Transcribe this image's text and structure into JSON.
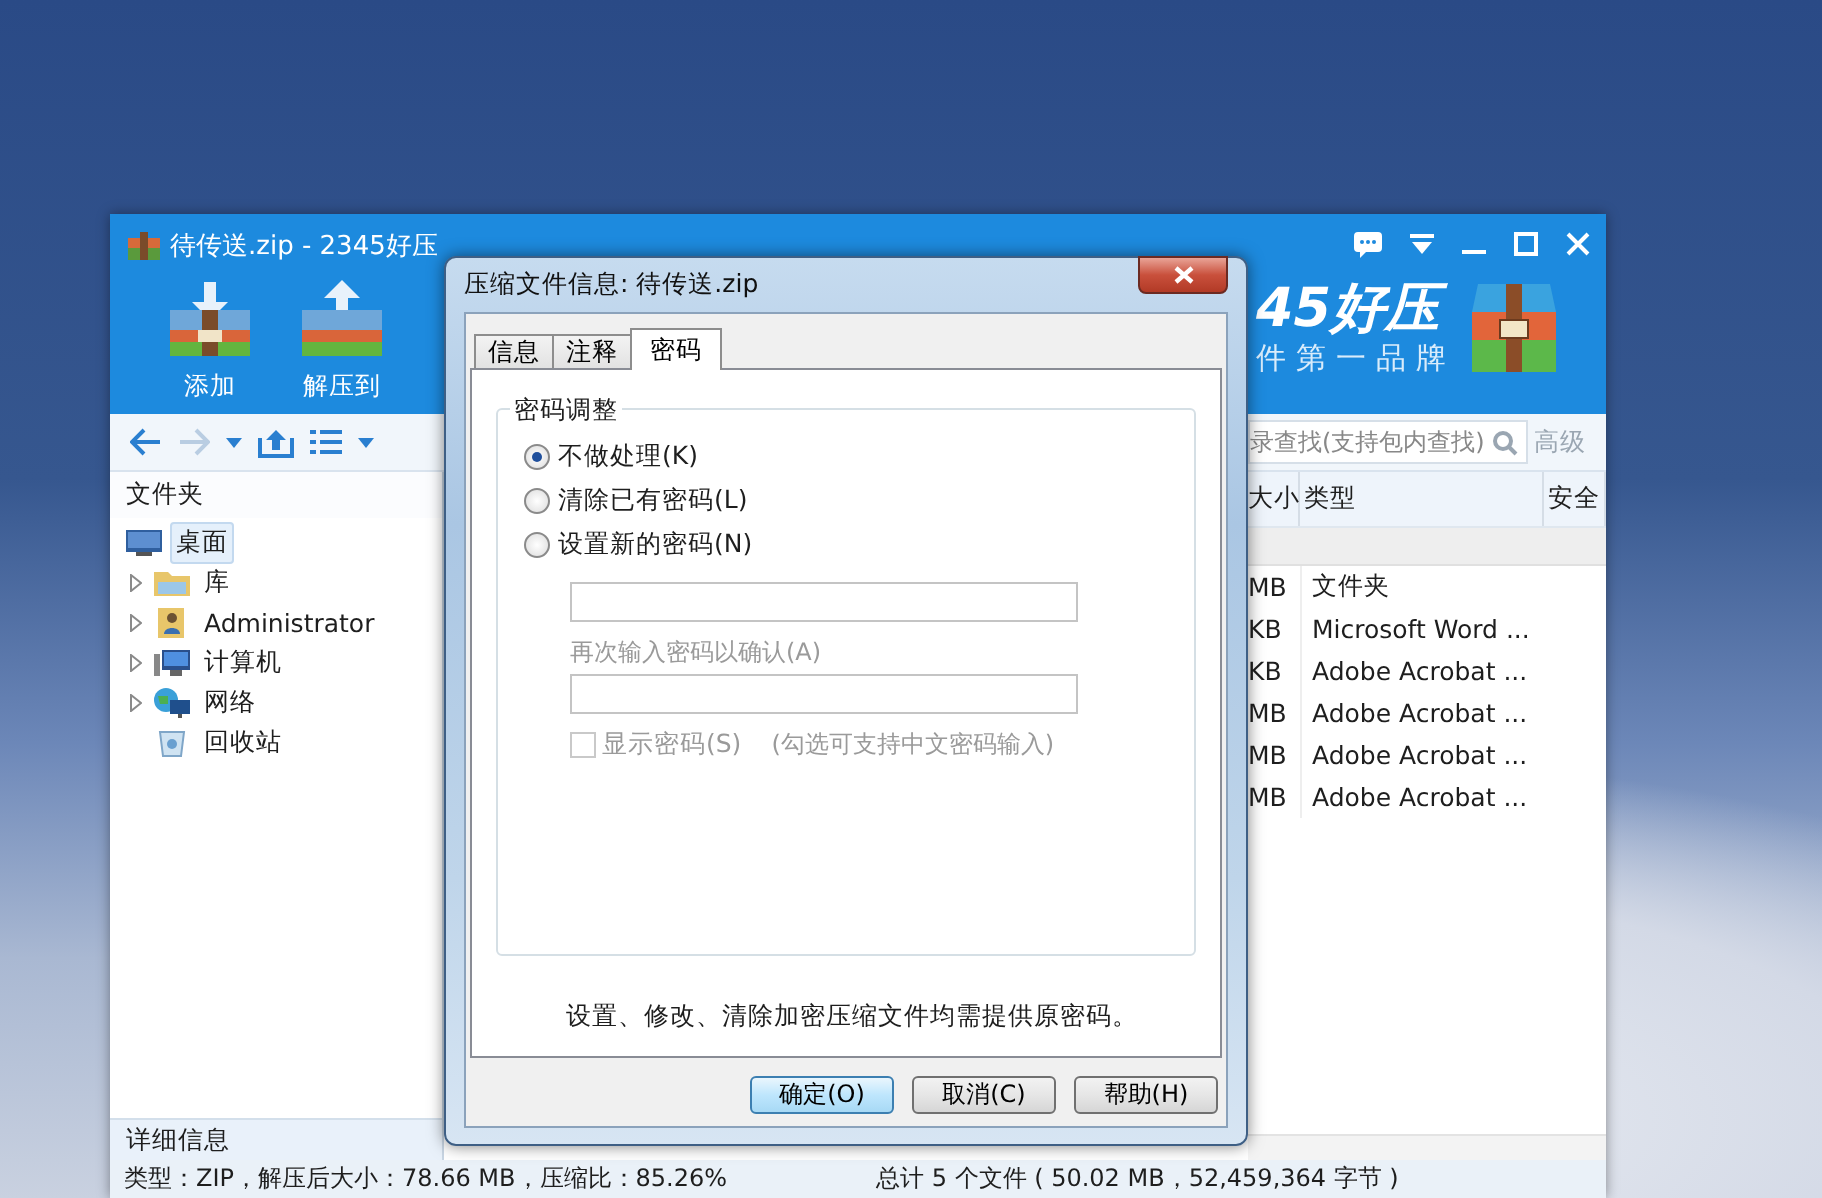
{
  "main_window": {
    "title": "待传送.zip - 2345好压",
    "toolbar": [
      {
        "label": "添加",
        "kind": "add"
      },
      {
        "label": "解压到",
        "kind": "extract"
      }
    ],
    "logo": {
      "name": "45好压",
      "slogan": "件第一品牌"
    },
    "search": {
      "placeholder": "录查找(支持包内查找)"
    },
    "advanced_link": "高级",
    "folder_pane": {
      "title": "文件夹",
      "tree": [
        {
          "label": "桌面",
          "kind": "desktop",
          "selected": true,
          "children": [
            {
              "label": "库",
              "kind": "library",
              "selected": false,
              "expandable": true
            },
            {
              "label": "Administrator",
              "kind": "user",
              "selected": false,
              "expandable": true
            },
            {
              "label": "计算机",
              "kind": "computer",
              "selected": false,
              "expandable": true
            },
            {
              "label": "网络",
              "kind": "network",
              "selected": false,
              "expandable": true
            },
            {
              "label": "回收站",
              "kind": "recycle",
              "selected": false,
              "expandable": false
            }
          ]
        }
      ]
    },
    "file_list": {
      "columns": [
        "大小",
        "类型",
        "安全"
      ],
      "rows": [
        {
          "size": "MB",
          "type": "文件夹"
        },
        {
          "size": "KB",
          "type": "Microsoft Word ..."
        },
        {
          "size": "KB",
          "type": "Adobe Acrobat ..."
        },
        {
          "size": "MB",
          "type": "Adobe Acrobat ..."
        },
        {
          "size": "MB",
          "type": "Adobe Acrobat ..."
        },
        {
          "size": "MB",
          "type": "Adobe Acrobat ..."
        }
      ]
    },
    "details_label": "详细信息",
    "status_bar": {
      "left": "类型：ZIP，解压后大小：78.66 MB，压缩比：85.26%",
      "right": "总计 5 个文件 ( 50.02 MB，52,459,364 字节 )"
    }
  },
  "dialog": {
    "title": "压缩文件信息: 待传送.zip",
    "tabs": [
      {
        "label": "信息",
        "selected": false
      },
      {
        "label": "注释",
        "selected": false
      },
      {
        "label": "密码",
        "selected": true
      }
    ],
    "group_title": "密码调整",
    "options": [
      {
        "label": "不做处理(K)",
        "selected": true
      },
      {
        "label": "清除已有密码(L)",
        "selected": false
      },
      {
        "label": "设置新的密码(N)",
        "selected": false
      }
    ],
    "password_fields": [
      {
        "disabled": true
      },
      {
        "label": "再次输入密码以确认(A)",
        "disabled": true
      }
    ],
    "show_password": {
      "label": "显示密码(S)",
      "checked": false,
      "disabled": true
    },
    "hint": "(勾选可支持中文密码输入)",
    "note": "设置、修改、清除加密压缩文件均需提供原密码。",
    "buttons": [
      {
        "label": "确定(O)",
        "default": true
      },
      {
        "label": "取消(C)",
        "default": false
      },
      {
        "label": "帮助(H)",
        "default": false
      }
    ]
  }
}
